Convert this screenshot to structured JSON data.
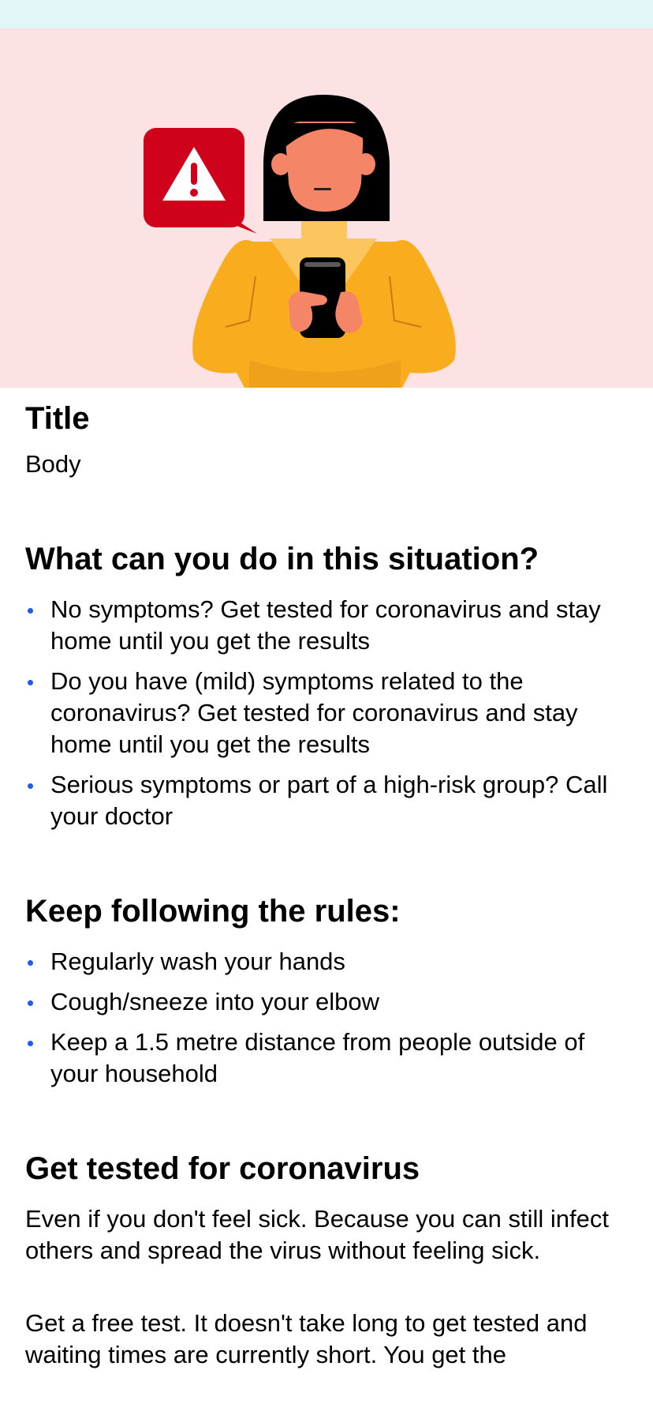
{
  "header": {
    "title": "Title",
    "body": "Body"
  },
  "illustration": {
    "icon": "warning-triangle-icon",
    "accent_color": "#d0021b",
    "background_color": "#fde2e4"
  },
  "sections": {
    "situation": {
      "heading": "What can you do in this situation?",
      "items": [
        "No symptoms? Get tested for coronavirus and stay home until you get the results",
        "Do you have (mild) symptoms related to the coronavirus? Get tested for coronavirus and stay home until you get the results",
        "Serious symptoms or part of a high-risk group? Call your doctor"
      ]
    },
    "rules": {
      "heading": "Keep following the rules:",
      "items": [
        "Regularly wash your hands",
        "Cough/sneeze into your elbow",
        "Keep a 1.5 metre distance from people outside of your household"
      ]
    },
    "testing": {
      "heading": "Get tested for coronavirus",
      "paragraph1": "Even if you don't feel sick. Because you can still infect others and spread the virus without feeling sick.",
      "paragraph2": "Get a free test. It doesn't take long to get tested and waiting times are currently short. You get the"
    }
  },
  "colors": {
    "bullet": "#1d5cf0",
    "status_bar": "#e2f6f8"
  }
}
